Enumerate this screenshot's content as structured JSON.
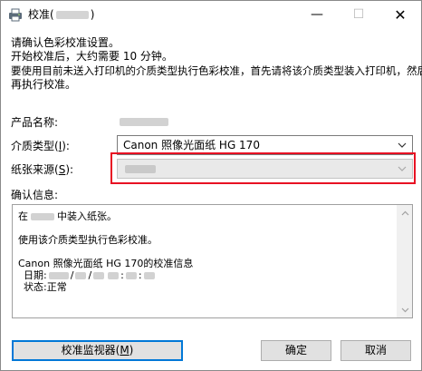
{
  "window": {
    "title_prefix": "校准(",
    "title_suffix": ")",
    "controls": {
      "minimize": "—",
      "maximize": "☐",
      "close": "✕"
    }
  },
  "intro": {
    "line1": "请确认色彩校准设置。",
    "line2": "开始校准后，大约需要 10 分钟。",
    "line3": "要使用目前未送入打印机的介质类型执行色彩校准，首先请将该介质类型装入打印机，然后",
    "line4": "再执行校准。"
  },
  "form": {
    "product_name_label": "产品名称:",
    "media_type_label": "介质类型(",
    "media_type_key": "I",
    "media_type_value": "Canon 照像光面纸 HG 170",
    "paper_source_label": "纸张来源(",
    "paper_source_key": "S",
    "label_end": "):"
  },
  "confirmation": {
    "label": "确认信息:",
    "line1_pre": "在",
    "line1_post": "中装入纸张。",
    "line2": "使用该介质类型执行色彩校准。",
    "line3": "Canon 照像光面纸 HG 170的校准信息",
    "date_label": "日期:",
    "date_sep1": "/",
    "date_sep2": "/",
    "time_sep1": ":",
    "time_sep2": ":",
    "status_label": "状态:",
    "status_value": "正常"
  },
  "buttons": {
    "monitor_pre": "校准监视器(",
    "monitor_key": "M",
    "monitor_post": ")",
    "ok": "确定",
    "cancel": "取消"
  },
  "colors": {
    "highlight": "#e81123",
    "default_button_border": "#0078d7"
  }
}
